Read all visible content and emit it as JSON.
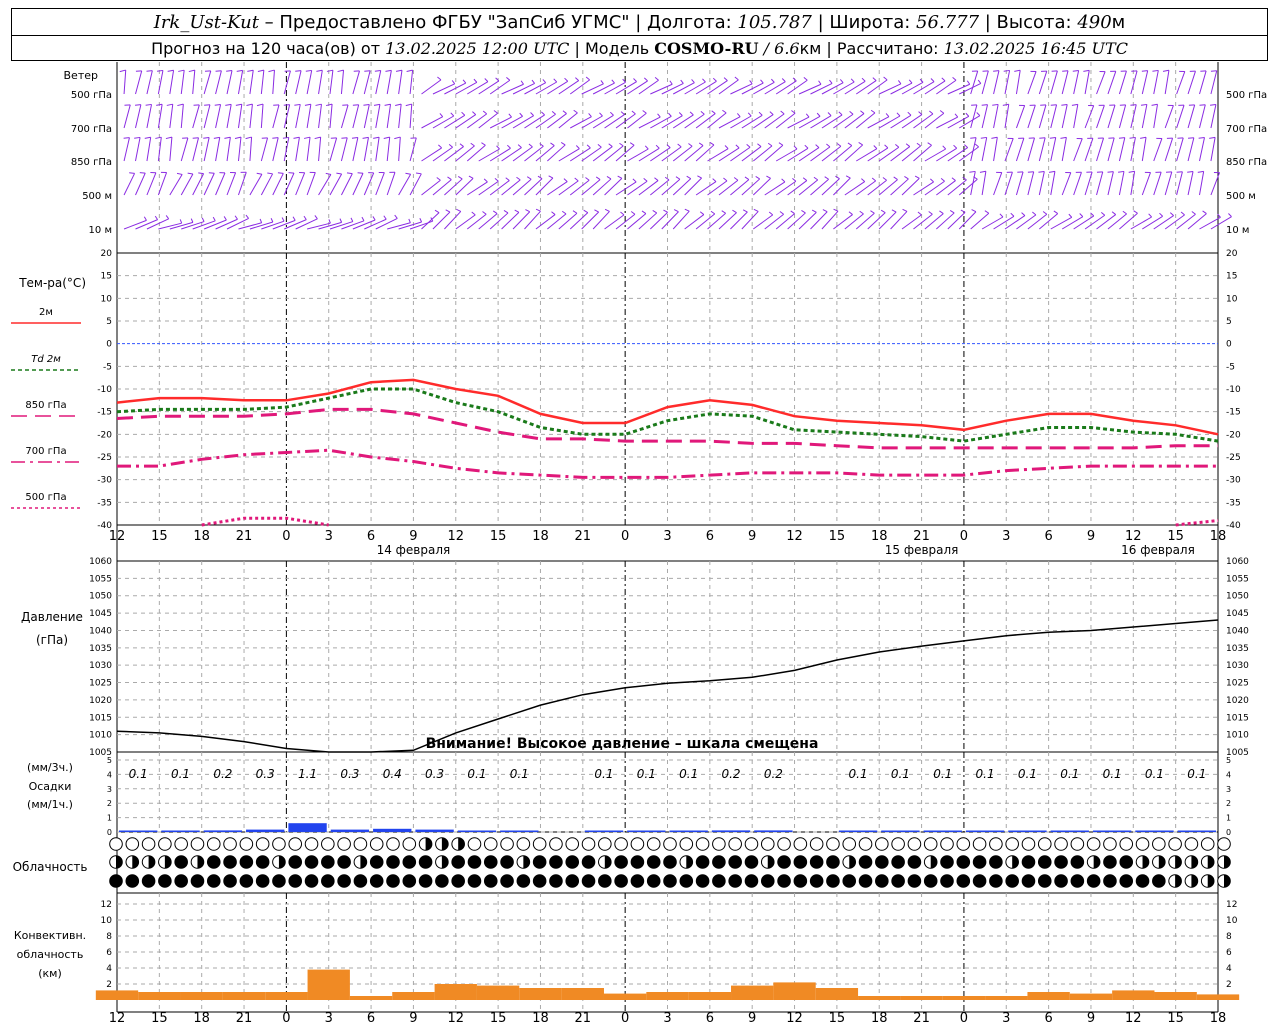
{
  "header": {
    "station": "Irk_Ust-Kut",
    "provider": " – Предоставлено ФГБУ \"ЗапСиб УГМС\" | Долгота: ",
    "lon": "105.787",
    "lat_label": " | Широта: ",
    "lat": "56.777",
    "alt_label": " | Высота: ",
    "alt": "490",
    "alt_unit": "м",
    "forecast_label": "Прогноз на 120 часа(ов) от ",
    "init_time": "13.02.2025 12:00 UTC",
    "model_label": " | Модель ",
    "model": "COSMO-RU",
    "res_sep": " / ",
    "resolution": "6.6",
    "res_unit": "км",
    "calc_label": " | Рассчитано: ",
    "calc_time": "13.02.2025 16:45 UTC"
  },
  "wind_panel": {
    "title": "Ветер",
    "levels": [
      "500 гПа",
      "700 гПа",
      "850 гПа",
      "500 м",
      "10 м"
    ]
  },
  "temp_panel": {
    "title": "Тем-ра(°C)",
    "legend": [
      {
        "label": "2м",
        "color": "#ff2b2b",
        "dash": ""
      },
      {
        "label": "Td 2м",
        "color": "#1a7a1a",
        "dash": "4,3"
      },
      {
        "label": "850 гПа",
        "color": "#e0187a",
        "dash": "16,8"
      },
      {
        "label": "700 гПа",
        "color": "#e0187a",
        "dash": "14,5,3,5"
      },
      {
        "label": "500 гПа",
        "color": "#e0187a",
        "dash": "3,3"
      }
    ]
  },
  "time_axis": {
    "hour_labels": [
      "12",
      "15",
      "18",
      "21",
      "0",
      "3",
      "6",
      "9",
      "12",
      "15",
      "18",
      "21",
      "0",
      "3",
      "6",
      "9",
      "12",
      "15",
      "18",
      "21",
      "0",
      "3",
      "6",
      "9",
      "12",
      "15",
      "18"
    ],
    "day_labels": [
      "14 февраля",
      "15 февраля",
      "16 февраля"
    ]
  },
  "pressure_panel": {
    "title": "Давление",
    "unit": "(гПа)",
    "warning": "Внимание! Высокое давление – шкала смещена"
  },
  "precip_panel": {
    "title": "Осадки",
    "unit_3h": "(мм/3ч.)",
    "unit_1h": "(мм/1ч.)",
    "labels": [
      "0.1",
      "0.1",
      "0.2",
      "0.3",
      "1.1",
      "0.3",
      "0.4",
      "0.3",
      "0.1",
      "0.1",
      "",
      "0.1",
      "0.1",
      "0.1",
      "0.2",
      "0.2",
      "",
      "0.1",
      "0.1",
      "0.1",
      "0.1",
      "0.1",
      "0.1",
      "0.1",
      "0.1",
      "0.1",
      ""
    ]
  },
  "cloud_panel": {
    "title": "Облачность"
  },
  "conv_panel": {
    "title": "Конвективн.",
    "title2": "облачность",
    "unit": "(км)"
  },
  "colors": {
    "temp2m": "#ff2b2b",
    "dew": "#1a7a1a",
    "upper": "#e0187a",
    "wind": "#8a2be2",
    "precip": "#2244ee",
    "conv": "#f08a24",
    "zero": "#3355ff"
  },
  "chart_data": [
    {
      "type": "line",
      "title": "Тем-ра(°C)",
      "x_hours": [
        0,
        3,
        6,
        9,
        12,
        15,
        18,
        21,
        24,
        27,
        30,
        33,
        36,
        39,
        42,
        45,
        48,
        51,
        54,
        57,
        60,
        63,
        66,
        69,
        72,
        75,
        78
      ],
      "ylim": [
        -40,
        20
      ],
      "series": [
        {
          "name": "2м",
          "values": [
            -13,
            -12,
            -12,
            -12.5,
            -12.5,
            -11,
            -8.5,
            -8,
            -10,
            -11.5,
            -15.5,
            -17.5,
            -17.5,
            -14,
            -12.5,
            -13.5,
            -16,
            -17,
            -17.5,
            -18,
            -19,
            -17,
            -15.5,
            -15.5,
            -17,
            -18,
            -20
          ]
        },
        {
          "name": "Td 2м",
          "values": [
            -15,
            -14.5,
            -14.5,
            -14.5,
            -14,
            -12,
            -10,
            -10,
            -13,
            -15,
            -18.5,
            -20,
            -20,
            -17,
            -15.5,
            -16,
            -19,
            -19.5,
            -20,
            -20.5,
            -21.5,
            -20,
            -18.5,
            -18.5,
            -19.5,
            -20,
            -21.5
          ]
        },
        {
          "name": "850 гПа",
          "values": [
            -16.5,
            -16,
            -16,
            -16,
            -15.5,
            -14.5,
            -14.5,
            -15.5,
            -17.5,
            -19.5,
            -21,
            -21,
            -21.5,
            -21.5,
            -21.5,
            -22,
            -22,
            -22.5,
            -23,
            -23,
            -23,
            -23,
            -23,
            -23,
            -23,
            -22.5,
            -22.5
          ]
        },
        {
          "name": "700 гПа",
          "values": [
            -27,
            -27,
            -25.5,
            -24.5,
            -24,
            -23.5,
            -25,
            -26,
            -27.5,
            -28.5,
            -29,
            -29.5,
            -29.5,
            -29.5,
            -29,
            -28.5,
            -28.5,
            -28.5,
            -29,
            -29,
            -29,
            -28,
            -27.5,
            -27,
            -27,
            -27,
            -27
          ]
        },
        {
          "name": "500 гПа",
          "values": [
            null,
            null,
            -40,
            -38.5,
            -38.5,
            -40,
            null,
            null,
            null,
            null,
            null,
            null,
            null,
            null,
            null,
            null,
            null,
            null,
            null,
            null,
            null,
            null,
            null,
            null,
            null,
            -40,
            -39
          ]
        }
      ]
    },
    {
      "type": "line",
      "title": "Давление",
      "x_hours": [
        0,
        3,
        6,
        9,
        12,
        15,
        18,
        21,
        24,
        27,
        30,
        33,
        36,
        39,
        42,
        45,
        48,
        51,
        54,
        57,
        60,
        63,
        66,
        69,
        72,
        75,
        78
      ],
      "ylim": [
        1005,
        1060
      ],
      "series": [
        {
          "name": "Давление",
          "values": [
            1011,
            1010.5,
            1009.5,
            1008,
            1006,
            1004,
            1003,
            1005.5,
            1010.5,
            1014.5,
            1018.5,
            1021.5,
            1023.5,
            1024.8,
            1025.5,
            1026.5,
            1028.5,
            1031.5,
            1033.8,
            1035.5,
            1037,
            1038.5,
            1039.5,
            1040,
            1041,
            1042,
            1043
          ]
        }
      ]
    },
    {
      "type": "bar",
      "title": "Осадки",
      "x_hours": [
        0,
        3,
        6,
        9,
        12,
        15,
        18,
        21,
        24,
        27,
        30,
        33,
        36,
        39,
        42,
        45,
        48,
        51,
        54,
        57,
        60,
        63,
        66,
        69,
        72,
        75,
        78
      ],
      "ylim": [
        0,
        5
      ],
      "values_3h": [
        0.1,
        0.1,
        0.2,
        0.3,
        1.1,
        0.3,
        0.4,
        0.3,
        0.1,
        0.1,
        0,
        0.1,
        0.1,
        0.1,
        0.2,
        0.2,
        0,
        0.1,
        0.1,
        0.1,
        0.1,
        0.1,
        0.1,
        0.1,
        0.1,
        0.1,
        0
      ]
    },
    {
      "type": "bar",
      "title": "Конвективн. облачность",
      "x_hours": [
        0,
        3,
        6,
        9,
        12,
        15,
        18,
        21,
        24,
        27,
        30,
        33,
        36,
        39,
        42,
        45,
        48,
        51,
        54,
        57,
        60,
        63,
        66,
        69,
        72,
        75,
        78
      ],
      "ylim": [
        0,
        13
      ],
      "values": [
        1.2,
        1,
        1,
        1,
        1,
        3.8,
        0.5,
        1,
        2,
        1.8,
        1.5,
        1.5,
        0.8,
        1,
        1,
        1.8,
        2.2,
        1.5,
        0.5,
        0.5,
        0.5,
        0.5,
        1,
        0.8,
        1.2,
        1,
        0.7
      ]
    }
  ]
}
